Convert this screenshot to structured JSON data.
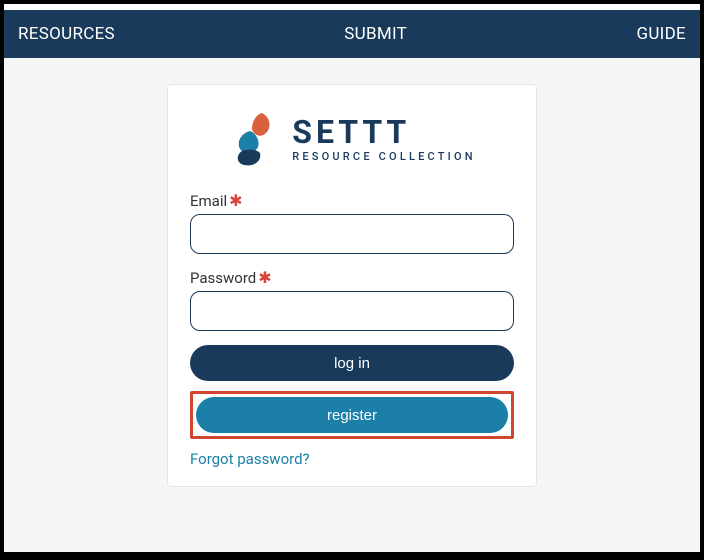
{
  "navbar": {
    "items": [
      {
        "label": "RESOURCES"
      },
      {
        "label": "SUBMIT"
      },
      {
        "label": "GUIDE"
      }
    ]
  },
  "logo": {
    "title": "SETTT",
    "subtitle": "RESOURCE COLLECTION"
  },
  "form": {
    "email": {
      "label": "Email",
      "required_marker": "✱",
      "value": ""
    },
    "password": {
      "label": "Password",
      "required_marker": "✱",
      "value": ""
    },
    "login_label": "log in",
    "register_label": "register",
    "forgot_label": "Forgot password?"
  }
}
